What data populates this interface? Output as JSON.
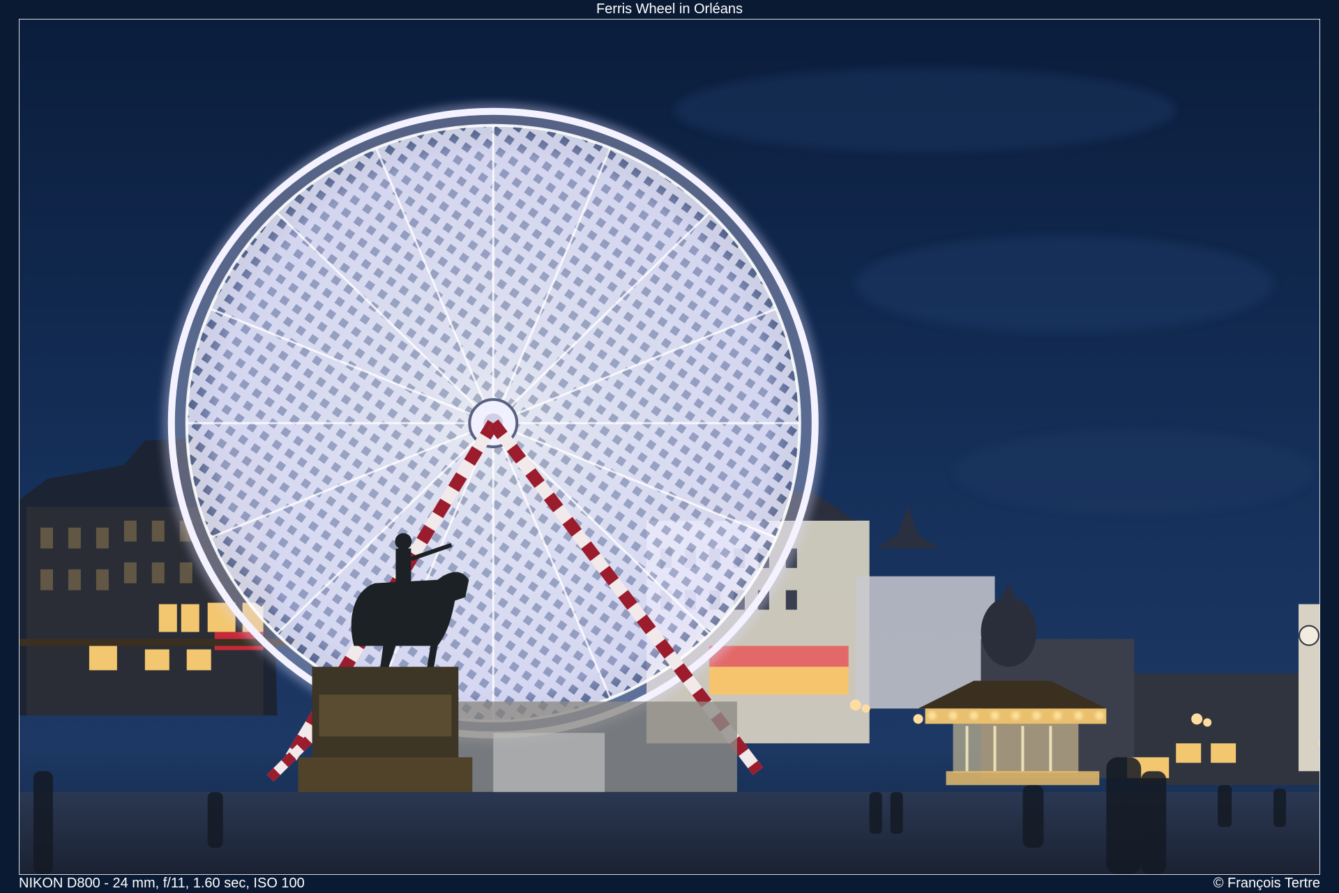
{
  "title": "Ferris Wheel in Orléans",
  "camera_info": "NIKON D800 - 24 mm, f/11, 1.60 sec, ISO 100",
  "copyright": "© François Tertre",
  "colors": {
    "frame": "#0a1a33",
    "sky_top": "#0c1f3f",
    "sky_bottom": "#1b3560",
    "wheel_glow": "#e8e6ff",
    "support_red": "#9b1c2c",
    "warm_light": "#f3c770"
  },
  "icons": {
    "wheel": "ferris-wheel-illustration",
    "statue": "equestrian-statue-silhouette",
    "carousel": "carousel-illustration"
  }
}
